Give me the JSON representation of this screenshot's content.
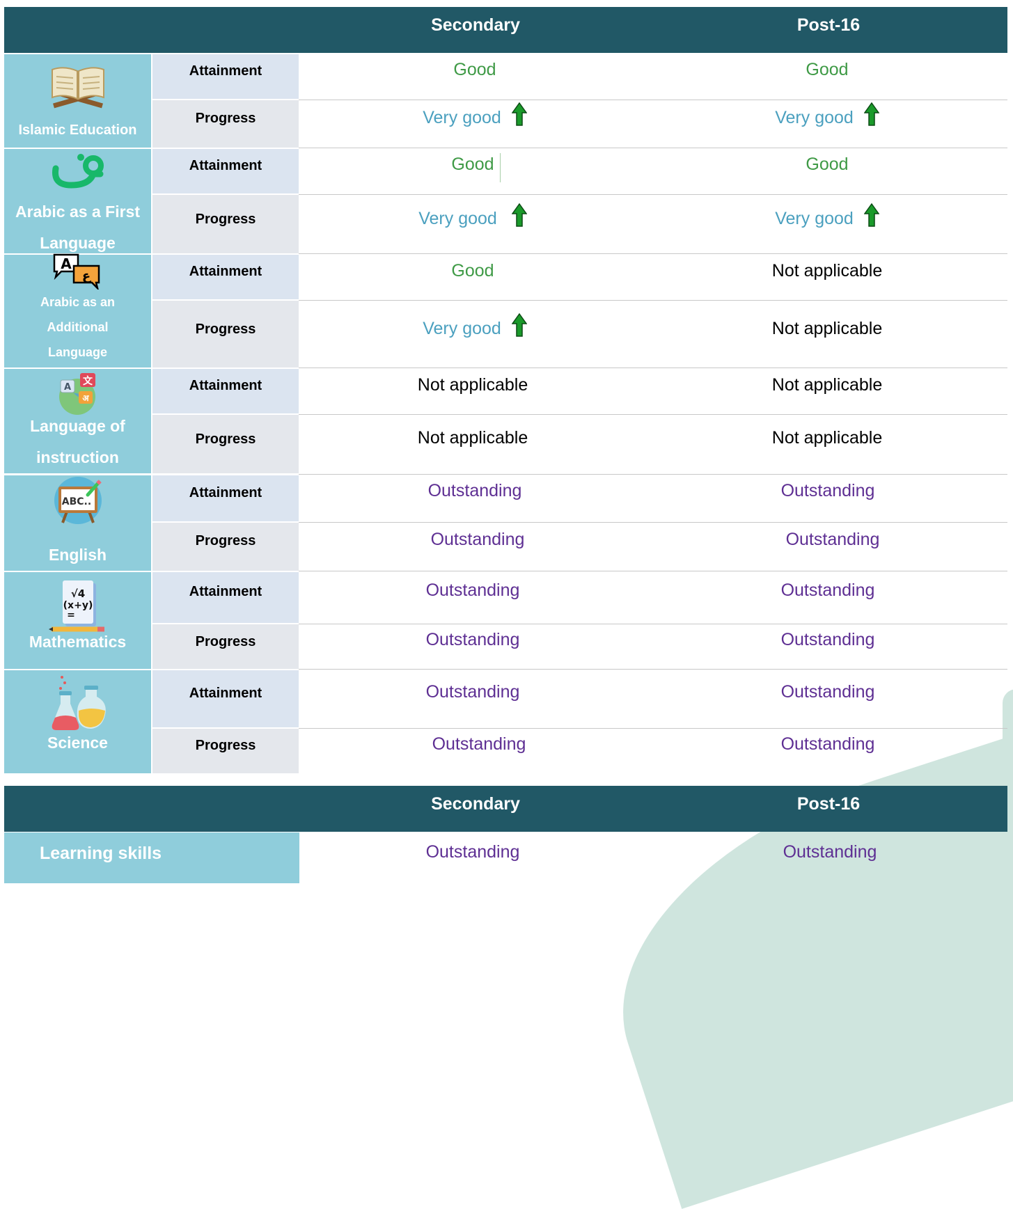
{
  "table1": {
    "header": {
      "col1": "Secondary",
      "col2": "Post-16"
    },
    "subjects": [
      {
        "name": "Islamic Education",
        "icon": "open-book-icon",
        "attainment": {
          "secondary": "Good",
          "post16": "Good"
        },
        "progress": {
          "secondary": "Very good",
          "post16": "Very good"
        }
      },
      {
        "name": "Arabic as a First Language",
        "icon": "arabic-letter-icon",
        "attainment": {
          "secondary": "Good",
          "post16": "Good"
        },
        "progress": {
          "secondary": "Very good",
          "post16": "Very good"
        }
      },
      {
        "name": "Arabic as an Additional Language",
        "icon": "translate-bubbles-icon",
        "attainment": {
          "secondary": "Good",
          "post16": "Not applicable"
        },
        "progress": {
          "secondary": "Very good",
          "post16": "Not applicable"
        }
      },
      {
        "name": "Language of instruction",
        "icon": "language-globe-icon",
        "attainment": {
          "secondary": "Not applicable",
          "post16": "Not applicable"
        },
        "progress": {
          "secondary": "Not applicable",
          "post16": "Not applicable"
        }
      },
      {
        "name": "English",
        "icon": "abc-board-icon",
        "attainment": {
          "secondary": "Outstanding",
          "post16": "Outstanding"
        },
        "progress": {
          "secondary": "Outstanding",
          "post16": "Outstanding"
        }
      },
      {
        "name": "Mathematics",
        "icon": "math-paper-icon",
        "attainment": {
          "secondary": "Outstanding",
          "post16": "Outstanding"
        },
        "progress": {
          "secondary": "Outstanding",
          "post16": "Outstanding"
        }
      },
      {
        "name": "Science",
        "icon": "flasks-icon",
        "attainment": {
          "secondary": "Outstanding",
          "post16": "Outstanding"
        },
        "progress": {
          "secondary": "Outstanding",
          "post16": "Outstanding"
        }
      }
    ],
    "row_labels": {
      "attainment": "Attainment",
      "progress": "Progress"
    }
  },
  "table2": {
    "header": {
      "col1": "Secondary",
      "col2": "Post-16"
    },
    "rows": [
      {
        "label": "Learning skills",
        "secondary": "Outstanding",
        "post16": "Outstanding"
      }
    ]
  },
  "colors": {
    "header": "#215866",
    "subject_bg": "#8fcddb",
    "good": "#3f9a46",
    "very_good": "#4ba0bf",
    "outstanding": "#5e2f93",
    "arrow": "#1a9a2a"
  }
}
